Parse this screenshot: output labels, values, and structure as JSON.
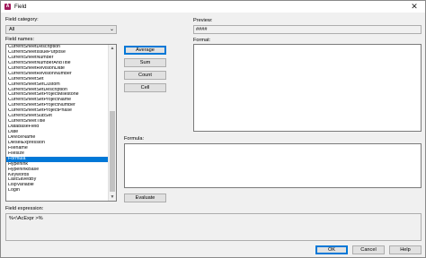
{
  "window": {
    "title": "Field",
    "close_glyph": "✕",
    "app_icon": "autocad-icon"
  },
  "left": {
    "category_label": "Field category:",
    "category_value": "All",
    "names_label": "Field names:",
    "field_names": [
      "CurrentSheetDescription",
      "CurrentSheetIssuePurpose",
      "CurrentSheetNumber",
      "CurrentSheetNumberAndTitle",
      "CurrentSheetRevisionDate",
      "CurrentSheetRevisionNumber",
      "CurrentSheetSet",
      "CurrentSheetSetCustom",
      "CurrentSheetSetDescription",
      "CurrentSheetSetProjectMilestone",
      "CurrentSheetSetProjectName",
      "CurrentSheetSetProjectNumber",
      "CurrentSheetSetProjectPhase",
      "CurrentSheetSubSet",
      "CurrentSheetTitle",
      "DatabaseField",
      "Date",
      "DeviceName",
      "DieselExpression",
      "Filename",
      "Filesize",
      "Formula",
      "Hyperlink",
      "HyperlinkBase",
      "Keywords",
      "LastSavedBy",
      "LispVariable",
      "Login"
    ],
    "selected_index": 21
  },
  "buttons": {
    "average": "Average",
    "sum": "Sum",
    "count": "Count",
    "cell": "Cell",
    "evaluate": "Evaluate",
    "ok": "OK",
    "cancel": "Cancel",
    "help": "Help"
  },
  "right": {
    "preview_label": "Preview:",
    "preview_value": "####",
    "format_label": "Format:",
    "formula_label": "Formula:"
  },
  "bottom": {
    "expression_label": "Field expression:",
    "expression_value": "%<\\AcExpr >%"
  }
}
